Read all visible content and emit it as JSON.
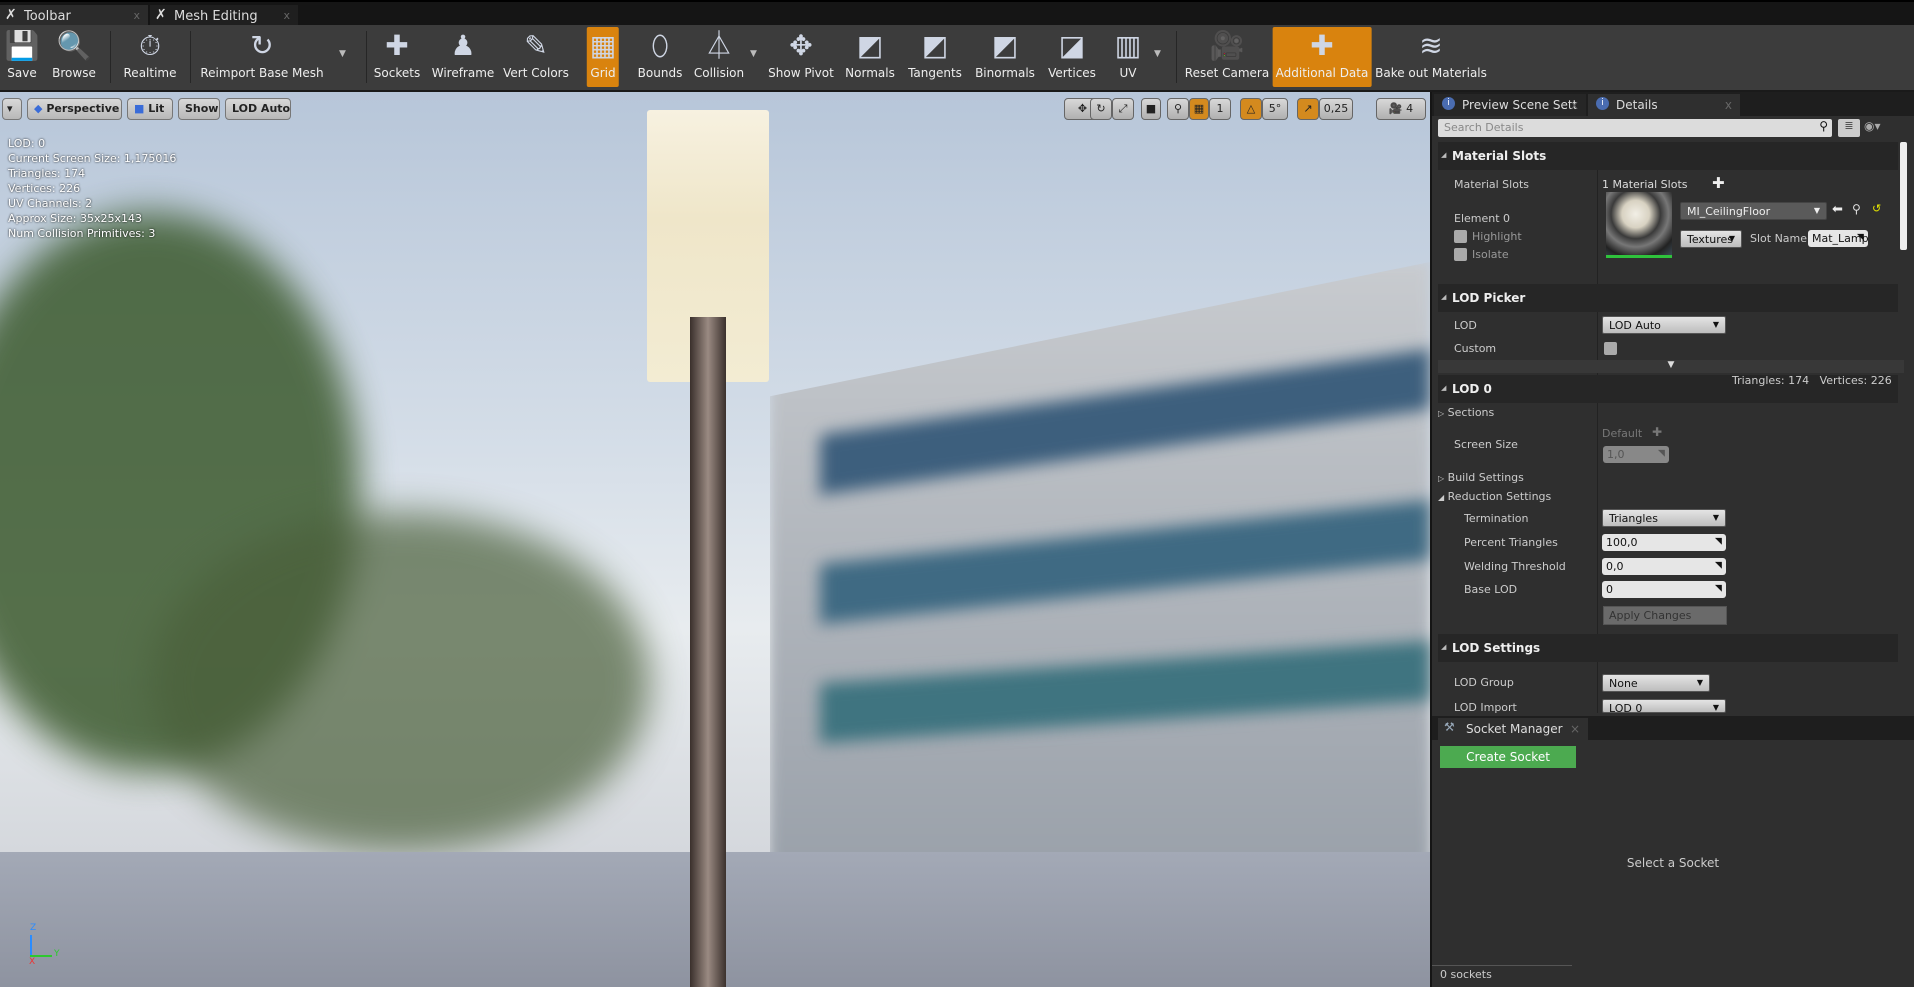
{
  "tabs": [
    {
      "label": "Toolbar",
      "icon": "wrench-icon"
    },
    {
      "label": "Mesh Editing",
      "icon": "wrench-icon"
    }
  ],
  "toolbar": {
    "buttons": [
      {
        "label": "Save",
        "icon": "floppy-icon",
        "glyph": "💾"
      },
      {
        "label": "Browse",
        "icon": "magnifier-icon",
        "glyph": "🔍"
      },
      {
        "label": "Realtime",
        "icon": "stopwatch-icon",
        "glyph": "⏱"
      },
      {
        "label": "Reimport Base Mesh",
        "icon": "reimport-icon",
        "glyph": "↻"
      },
      {
        "label": "Sockets",
        "icon": "socket-icon",
        "glyph": "✚"
      },
      {
        "label": "Wireframe",
        "icon": "wireframe-icon",
        "glyph": "♟"
      },
      {
        "label": "Vert Colors",
        "icon": "vert-colors-icon",
        "glyph": "✎"
      },
      {
        "label": "Grid",
        "icon": "grid-icon",
        "glyph": "▦",
        "active": true
      },
      {
        "label": "Bounds",
        "icon": "bounds-icon",
        "glyph": "⬯"
      },
      {
        "label": "Collision",
        "icon": "collision-icon",
        "glyph": "⏃"
      },
      {
        "label": "Show Pivot",
        "icon": "pivot-icon",
        "glyph": "✥"
      },
      {
        "label": "Normals",
        "icon": "normals-icon",
        "glyph": "◩"
      },
      {
        "label": "Tangents",
        "icon": "tangents-icon",
        "glyph": "◩"
      },
      {
        "label": "Binormals",
        "icon": "binormals-icon",
        "glyph": "◩"
      },
      {
        "label": "Vertices",
        "icon": "vertices-icon",
        "glyph": "◪"
      },
      {
        "label": "UV",
        "icon": "uv-icon",
        "glyph": "▥"
      },
      {
        "label": "Reset Camera",
        "icon": "camera-icon",
        "glyph": "🎥"
      },
      {
        "label": "Additional Data",
        "icon": "additional-data-icon",
        "glyph": "✚",
        "active": true
      },
      {
        "label": "Bake out Materials",
        "icon": "layers-icon",
        "glyph": "≋"
      }
    ]
  },
  "viewport": {
    "buttons": [
      "Perspective",
      "Lit",
      "Show",
      "LOD Auto"
    ],
    "stats": [
      "LOD:  0",
      "Current Screen Size:  1,175016",
      "Triangles:  174",
      "Vertices:  226",
      "UV Channels:  2",
      "Approx Size: 35x25x143",
      "Num Collision Primitives:  3"
    ],
    "grid_snap": "1",
    "rot_snap": "5°",
    "scale_snap": "0,25",
    "cam_speed": "4",
    "axes": {
      "z": "Z",
      "y": "Y",
      "x": "X"
    }
  },
  "panel": {
    "tabs": [
      "Preview Scene Sett",
      "Details"
    ],
    "search_placeholder": "Search Details",
    "material_slots": {
      "header": "Material Slots",
      "label": "Material Slots",
      "value": "1 Material Slots",
      "element": "Element 0",
      "highlight": "Highlight",
      "isolate": "Isolate",
      "material": "MI_CeilingFloor",
      "textures": "Textures",
      "slot_name_label": "Slot Name",
      "slot_name": "Mat_Lamp"
    },
    "lod_picker": {
      "header": "LOD Picker",
      "lod_label": "LOD",
      "lod_value": "LOD Auto",
      "custom": "Custom"
    },
    "lod0": {
      "header": "LOD 0",
      "stats": "Triangles: 174   Vertices: 226",
      "sections": "Sections",
      "screen_size": "Screen Size",
      "default": "Default",
      "screen_value": "1,0",
      "build": "Build Settings",
      "reduction": "Reduction Settings",
      "termination": "Termination",
      "termination_value": "Triangles",
      "percent": "Percent Triangles",
      "percent_value": "100,0",
      "welding": "Welding Threshold",
      "welding_value": "0,0",
      "base_lod": "Base LOD",
      "base_lod_value": "0",
      "apply": "Apply Changes"
    },
    "lod_settings": {
      "header": "LOD Settings",
      "group": "LOD Group",
      "group_value": "None",
      "import": "LOD Import",
      "import_value": "LOD 0"
    }
  },
  "sockets": {
    "tab": "Socket Manager",
    "create": "Create Socket",
    "empty": "Select a Socket",
    "count": "0 sockets"
  },
  "colors": {
    "accent": "#d9830e",
    "create_socket": "#4caa50"
  }
}
